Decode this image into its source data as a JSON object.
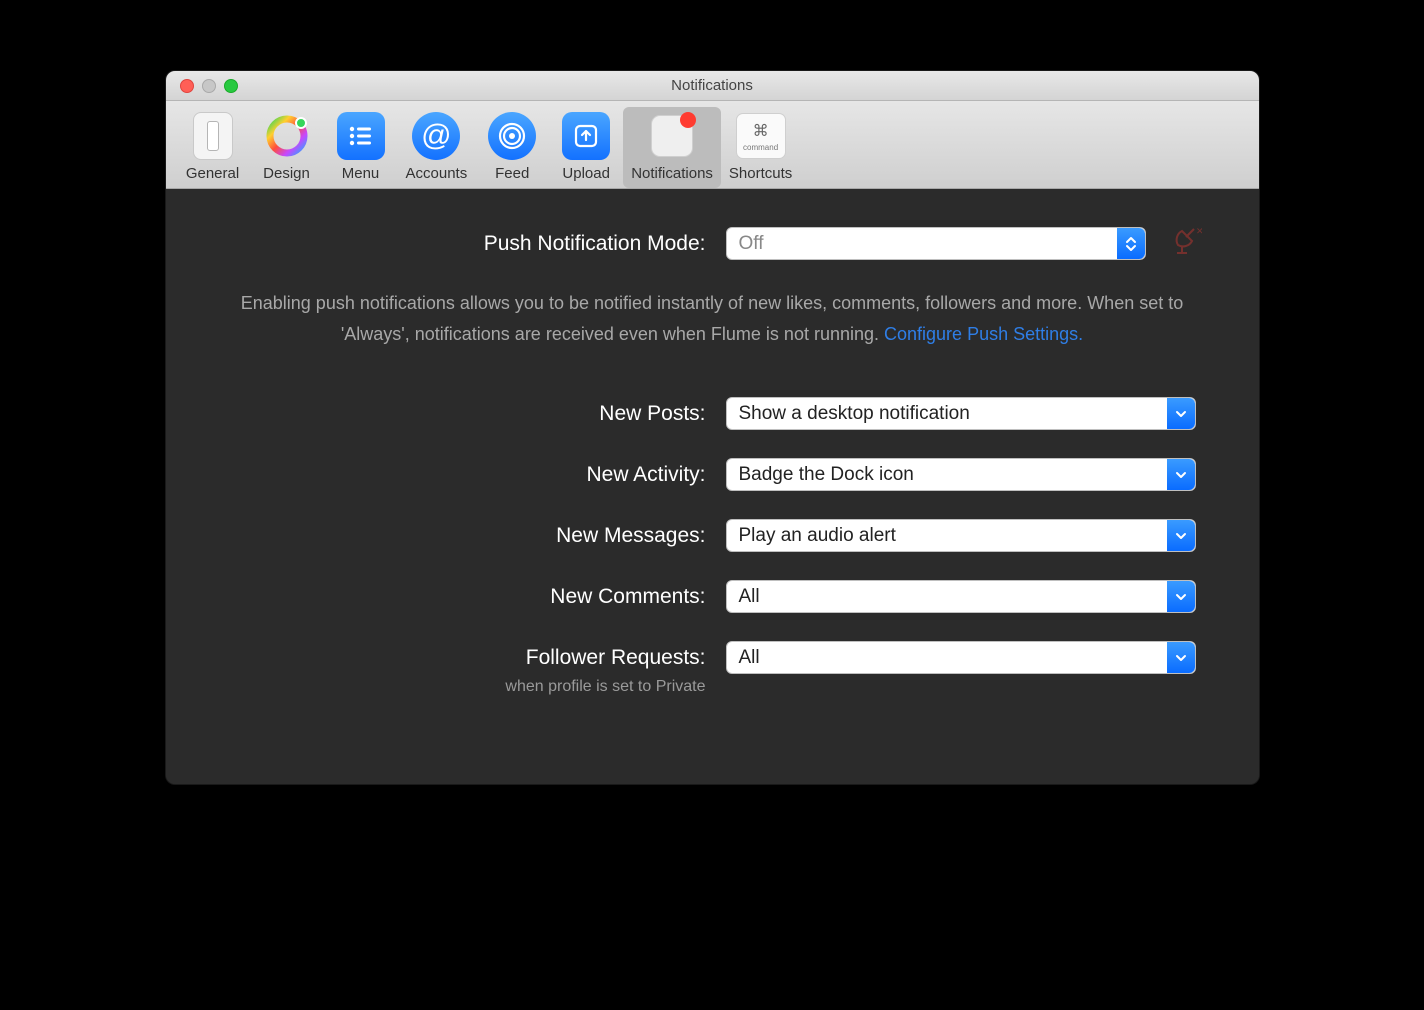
{
  "window": {
    "title": "Notifications"
  },
  "toolbar": {
    "items": [
      {
        "label": "General"
      },
      {
        "label": "Design"
      },
      {
        "label": "Menu"
      },
      {
        "label": "Accounts"
      },
      {
        "label": "Feed"
      },
      {
        "label": "Upload"
      },
      {
        "label": "Notifications"
      },
      {
        "label": "Shortcuts"
      }
    ]
  },
  "push": {
    "mode_label": "Push Notification Mode:",
    "mode_value": "Off",
    "description_pre": "Enabling push notifications allows you to be notified instantly of new likes, comments, followers and more. When set to 'Always', notifications are received even when Flume is not running. ",
    "configure_link": "Configure Push Settings."
  },
  "settings": {
    "new_posts": {
      "label": "New Posts:",
      "value": "Show a desktop notification"
    },
    "new_activity": {
      "label": "New Activity:",
      "value": "Badge the Dock icon"
    },
    "new_messages": {
      "label": "New Messages:",
      "value": "Play an audio alert"
    },
    "new_comments": {
      "label": "New Comments:",
      "value": "All"
    },
    "follower_requests": {
      "label": "Follower Requests:",
      "value": "All",
      "sublabel": "when profile is set to Private"
    }
  }
}
